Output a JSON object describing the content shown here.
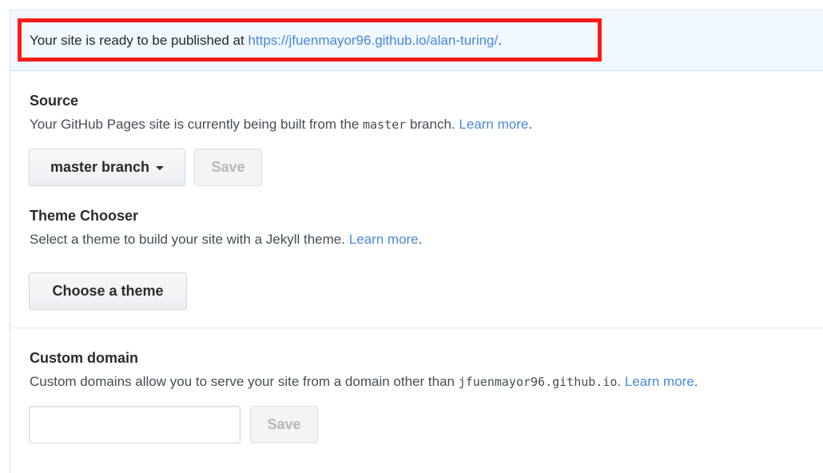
{
  "flash": {
    "text": "Your site is ready to be published at ",
    "url": "https://jfuenmayor96.github.io/alan-turing/",
    "suffix": "."
  },
  "source": {
    "title": "Source",
    "desc_prefix": "Your GitHub Pages site is currently being built from the ",
    "branch_code": "master",
    "desc_suffix": " branch. ",
    "learn_more": "Learn more",
    "learn_more_suffix": ".",
    "branch_button": "master branch",
    "save_button": "Save"
  },
  "theme": {
    "title": "Theme Chooser",
    "desc": "Select a theme to build your site with a Jekyll theme. ",
    "learn_more": "Learn more",
    "learn_more_suffix": ".",
    "button": "Choose a theme"
  },
  "custom_domain": {
    "title": "Custom domain",
    "desc_prefix": "Custom domains allow you to serve your site from a domain other than ",
    "domain_code": "jfuenmayor96.github.io",
    "desc_suffix": ". ",
    "learn_more": "Learn more",
    "learn_more_suffix": ".",
    "input_value": "",
    "save_button": "Save"
  },
  "colors": {
    "link": "#4a88d9",
    "highlight": "#ff1a1a",
    "flash_bg": "#f1f8ff"
  }
}
